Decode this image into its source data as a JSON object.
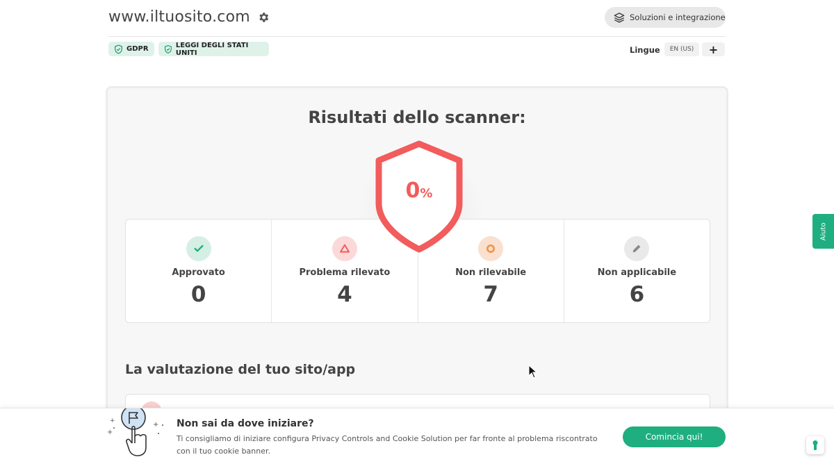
{
  "header": {
    "site_url": "www.iltuosito.com",
    "solutions_label": "Soluzioni e integrazione"
  },
  "laws": [
    {
      "label": "GDPR"
    },
    {
      "label": "LEGGI DEGLI STATI UNITI"
    }
  ],
  "languages": {
    "label": "Lingue",
    "current": "EN (US)",
    "add_label": "+"
  },
  "scanner": {
    "title": "Risultati dello scanner:",
    "score_value": "0",
    "score_unit": "%",
    "score_color": "#f25c5c",
    "stats": [
      {
        "label": "Approvato",
        "value": "0",
        "icon": "check-icon",
        "color": "#1fae7f"
      },
      {
        "label": "Problema rilevato",
        "value": "4",
        "icon": "warning-triangle-icon",
        "color": "#f25c5c"
      },
      {
        "label": "Non rilevabile",
        "value": "7",
        "icon": "circle-icon",
        "color": "#f0954a"
      },
      {
        "label": "Non applicabile",
        "value": "6",
        "icon": "pencil-icon",
        "color": "#888888"
      }
    ]
  },
  "evaluation": {
    "title": "La valutazione del tuo sito/app"
  },
  "help_tab": {
    "label": "Aiuto"
  },
  "bottom_banner": {
    "title": "Non sai da dove iniziare?",
    "text": "Ti consigliamo di iniziare configura Privacy Controls and Cookie Solution per far fronte al problema riscontrato con il tuo cookie banner.",
    "button_label": "Comincia qui!"
  },
  "colors": {
    "accent_green": "#1fae7f",
    "danger_red": "#f25c5c"
  }
}
